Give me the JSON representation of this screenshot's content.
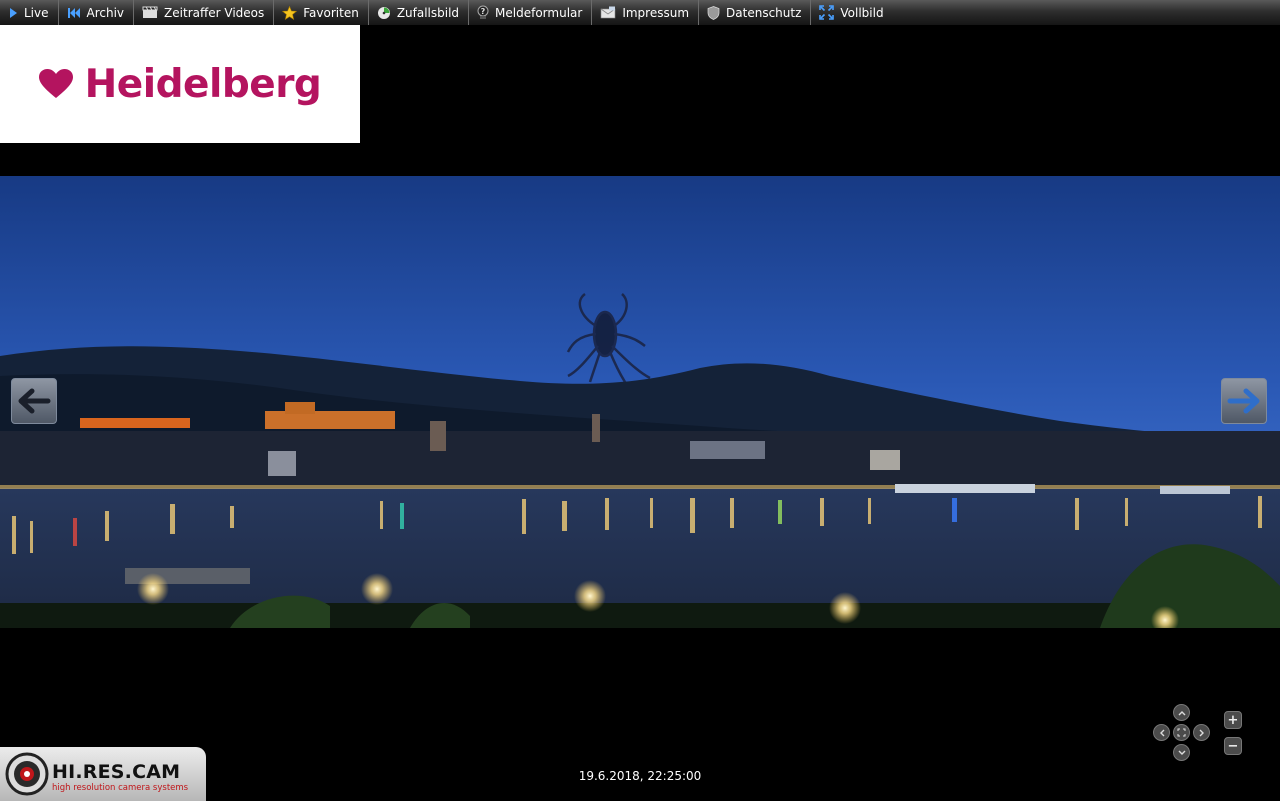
{
  "nav": {
    "items": [
      {
        "label": "Live",
        "icon": "play-icon"
      },
      {
        "label": "Archiv",
        "icon": "rewind-icon"
      },
      {
        "label": "Zeitraffer Videos",
        "icon": "film-icon"
      },
      {
        "label": "Favoriten",
        "icon": "star-icon"
      },
      {
        "label": "Zufallsbild",
        "icon": "random-image-icon"
      },
      {
        "label": "Meldeformular",
        "icon": "help-icon"
      },
      {
        "label": "Impressum",
        "icon": "mail-icon"
      },
      {
        "label": "Datenschutz",
        "icon": "shield-icon"
      },
      {
        "label": "Vollbild",
        "icon": "fullscreen-icon"
      }
    ]
  },
  "logo": {
    "text": "Heidelberg",
    "color": "#b4145f"
  },
  "viewer": {
    "timestamp": "19.6.2018, 22:25:00",
    "prev_icon": "arrow-left-icon",
    "next_icon": "arrow-right-icon"
  },
  "brand": {
    "name": "HI.RES.CAM",
    "tagline": "high resolution camera systems"
  },
  "controls": {
    "zoom_in": "+",
    "zoom_out": "−"
  }
}
